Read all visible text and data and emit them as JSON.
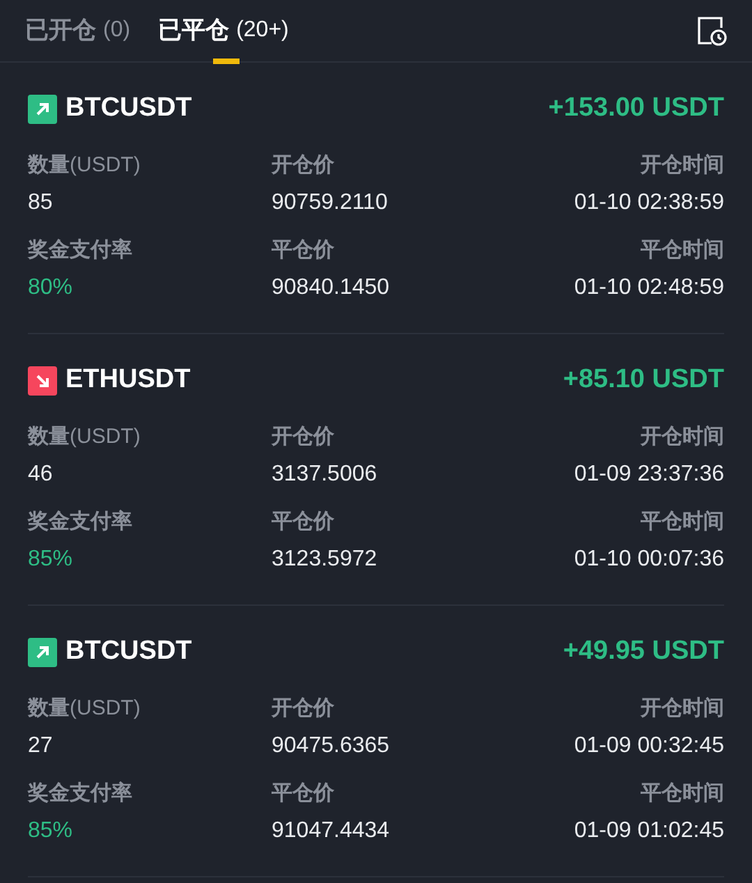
{
  "tabs": [
    {
      "label": "已开仓",
      "count": "(0)",
      "selected": false
    },
    {
      "label": "已平仓",
      "count": "(20+)",
      "selected": true
    }
  ],
  "trades": [
    {
      "symbol": "BTCUSDT",
      "kind": "up",
      "pnl": "+153.00 USDT",
      "fields": [
        {
          "label": "数量",
          "unit": "(USDT)",
          "value": "85",
          "highlight": false
        },
        {
          "label": "开仓价",
          "value": "90759.2110",
          "highlight": false
        },
        {
          "label": "开仓时间",
          "value": "01-10 02:38:59",
          "highlight": false
        },
        {
          "label": "奖金支付率",
          "value": "80%",
          "highlight": true
        },
        {
          "label": "平仓价",
          "value": "90840.1450",
          "highlight": false
        },
        {
          "label": "平仓时间",
          "value": "01-10 02:48:59",
          "highlight": false
        }
      ]
    },
    {
      "symbol": "ETHUSDT",
      "kind": "down",
      "pnl": "+85.10 USDT",
      "fields": [
        {
          "label": "数量",
          "unit": "(USDT)",
          "value": "46",
          "highlight": false
        },
        {
          "label": "开仓价",
          "value": "3137.5006",
          "highlight": false
        },
        {
          "label": "开仓时间",
          "value": "01-09 23:37:36",
          "highlight": false
        },
        {
          "label": "奖金支付率",
          "value": "85%",
          "highlight": true
        },
        {
          "label": "平仓价",
          "value": "3123.5972",
          "highlight": false
        },
        {
          "label": "平仓时间",
          "value": "01-10 00:07:36",
          "highlight": false
        }
      ]
    },
    {
      "symbol": "BTCUSDT",
      "kind": "up",
      "pnl": "+49.95 USDT",
      "fields": [
        {
          "label": "数量",
          "unit": "(USDT)",
          "value": "27",
          "highlight": false
        },
        {
          "label": "开仓价",
          "value": "90475.6365",
          "highlight": false
        },
        {
          "label": "开仓时间",
          "value": "01-09 00:32:45",
          "highlight": false
        },
        {
          "label": "奖金支付率",
          "value": "85%",
          "highlight": true
        },
        {
          "label": "平仓价",
          "value": "91047.4434",
          "highlight": false
        },
        {
          "label": "平仓时间",
          "value": "01-09 01:02:45",
          "highlight": false
        }
      ]
    }
  ]
}
